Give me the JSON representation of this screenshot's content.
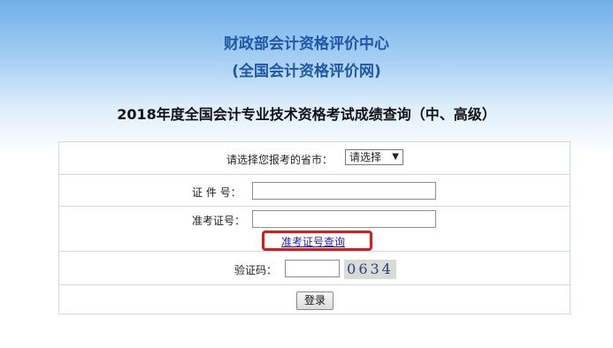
{
  "header": {
    "title_line1": "财政部会计资格评价中心",
    "title_line2": "(全国会计资格评价网)"
  },
  "exam_title": "2018年度全国会计专业技术资格考试成绩查询（中、高级）",
  "form": {
    "province_label": "请选择您报考的省市：",
    "province_selected": "请选择",
    "id_label": "证 件 号：",
    "id_value": "",
    "ticket_label": "准考证号：",
    "ticket_value": "",
    "ticket_lookup_link": "准考证号查询",
    "captcha_label": "验证码：",
    "captcha_input_value": "",
    "captcha_image_text": "0634",
    "login_button": "登录"
  },
  "colors": {
    "title_blue": "#1f57a8",
    "highlight_red": "#e11818",
    "link": "#2222aa"
  }
}
